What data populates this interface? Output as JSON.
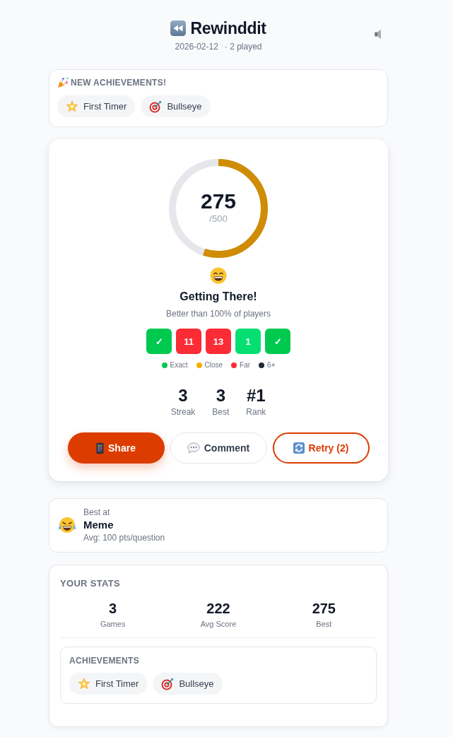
{
  "header": {
    "title": "Rewinddit",
    "date": "2026-02-12",
    "played": "· 2 played"
  },
  "new_achievements": {
    "heading": "NEW ACHIEVEMENTS!",
    "items": [
      {
        "label": "First Timer",
        "kind": "star"
      },
      {
        "label": "Bullseye",
        "kind": "target"
      }
    ]
  },
  "result": {
    "score": "275",
    "max": "/500",
    "level": 0.55,
    "verdict": "Getting There!",
    "percentile": "Better than 100% of players",
    "tiles": [
      {
        "label": "✓",
        "color": "#00c950"
      },
      {
        "label": "11",
        "color": "#fb2c36"
      },
      {
        "label": "13",
        "color": "#fb2c36"
      },
      {
        "label": "1",
        "color": "#05df72"
      },
      {
        "label": "✓",
        "color": "#00c950"
      }
    ],
    "legend": [
      {
        "label": "Exact",
        "color": "#00c950"
      },
      {
        "label": "Close",
        "color": "#f0b100"
      },
      {
        "label": "Far",
        "color": "#fb2c36"
      },
      {
        "label": "6+",
        "color": "#1e2939"
      }
    ],
    "summary": [
      {
        "value": "3",
        "label": "Streak"
      },
      {
        "value": "3",
        "label": "Best"
      },
      {
        "value": "#1",
        "label": "Rank"
      }
    ],
    "buttons": [
      {
        "label": "Share",
        "kind": "share"
      },
      {
        "label": "Comment",
        "kind": "comment"
      },
      {
        "label": "Retry (2)",
        "kind": "retry"
      }
    ]
  },
  "best_at": {
    "caption": "Best at",
    "category": "Meme",
    "average": "Avg: 100 pts/question"
  },
  "your_stats": {
    "heading": "YOUR STATS",
    "items": [
      {
        "value": "3",
        "label": "Games"
      },
      {
        "value": "222",
        "label": "Avg Score"
      },
      {
        "value": "275",
        "label": "Best"
      }
    ],
    "achievements": {
      "heading": "ACHIEVEMENTS",
      "items": [
        {
          "label": "First Timer",
          "kind": "star"
        },
        {
          "label": "Bullseye",
          "kind": "target"
        }
      ]
    }
  }
}
